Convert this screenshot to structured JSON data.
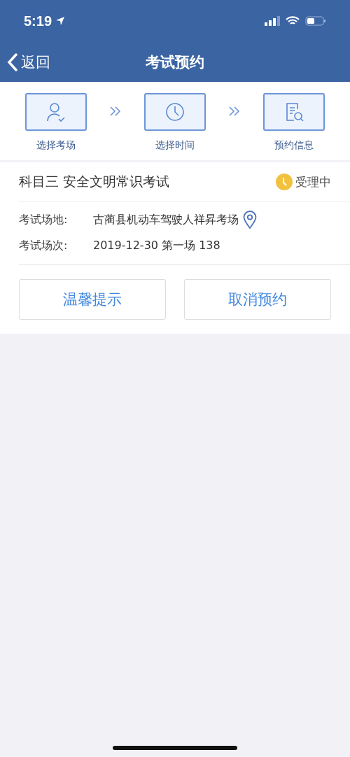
{
  "status_bar": {
    "time": "5:19"
  },
  "nav": {
    "back": "返回",
    "title": "考试预约"
  },
  "steps": [
    {
      "kind": "person",
      "label": "选择考场"
    },
    {
      "kind": "clock",
      "label": "选择时间"
    },
    {
      "kind": "document",
      "label": "预约信息"
    }
  ],
  "card": {
    "title": "科目三 安全文明常识考试",
    "status": "受理中",
    "fields": [
      {
        "label": "考试场地:",
        "value": "古蔺县机动车驾驶人祥昇考场",
        "kind": "location"
      },
      {
        "label": "考试场次:",
        "value": "2019-12-30 第一场 138",
        "kind": "plain"
      }
    ],
    "buttons": [
      "温馨提示",
      "取消预约"
    ]
  }
}
